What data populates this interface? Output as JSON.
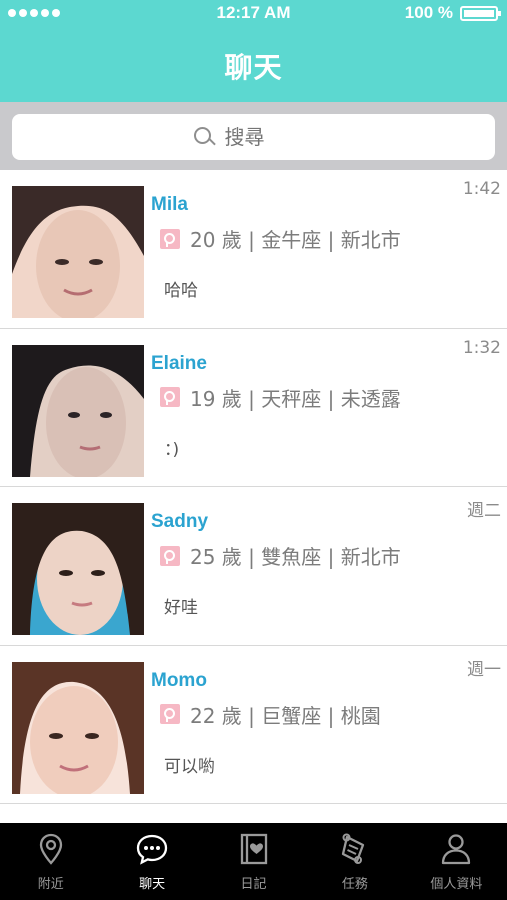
{
  "status_bar": {
    "time": "12:17 AM",
    "battery": "100 %"
  },
  "header": {
    "title": "聊天"
  },
  "search": {
    "placeholder": "搜尋"
  },
  "chats": [
    {
      "name": "Mila",
      "time": "1:42",
      "info": "20 歲 | 金牛座 | 新北市",
      "message": "哈哈",
      "avatar_colors": [
        "#3a2a28",
        "#e8c7b7",
        "#f1d6c9"
      ]
    },
    {
      "name": "Elaine",
      "time": "1:32",
      "info": "19 歲 | 天秤座 | 未透露",
      "message": "：)",
      "avatar_colors": [
        "#1e1a1c",
        "#d9c0b6",
        "#e3cfc5"
      ]
    },
    {
      "name": "Sadny",
      "time": "週二",
      "info": "25 歲 | 雙魚座 | 新北市",
      "message": "好哇",
      "avatar_colors": [
        "#2d1f1a",
        "#edd3c6",
        "#3aa6cf"
      ]
    },
    {
      "name": "Momo",
      "time": "週一",
      "info": "22 歲 | 巨蟹座 | 桃園",
      "message": "可以喲",
      "avatar_colors": [
        "#5a3426",
        "#f0cdbd",
        "#f7e3da"
      ]
    }
  ],
  "tabs": [
    {
      "label": "附近",
      "icon": "location-pin-icon",
      "active": false
    },
    {
      "label": "聊天",
      "icon": "chat-bubble-icon",
      "active": true
    },
    {
      "label": "日記",
      "icon": "diary-icon",
      "active": false
    },
    {
      "label": "任務",
      "icon": "task-scroll-icon",
      "active": false
    },
    {
      "label": "個人資料",
      "icon": "person-icon",
      "active": false
    }
  ],
  "colors": {
    "header": "#5cd8d0",
    "name": "#2ba3d0",
    "female_badge": "#f6b8c4",
    "tabbar": "#000000"
  }
}
